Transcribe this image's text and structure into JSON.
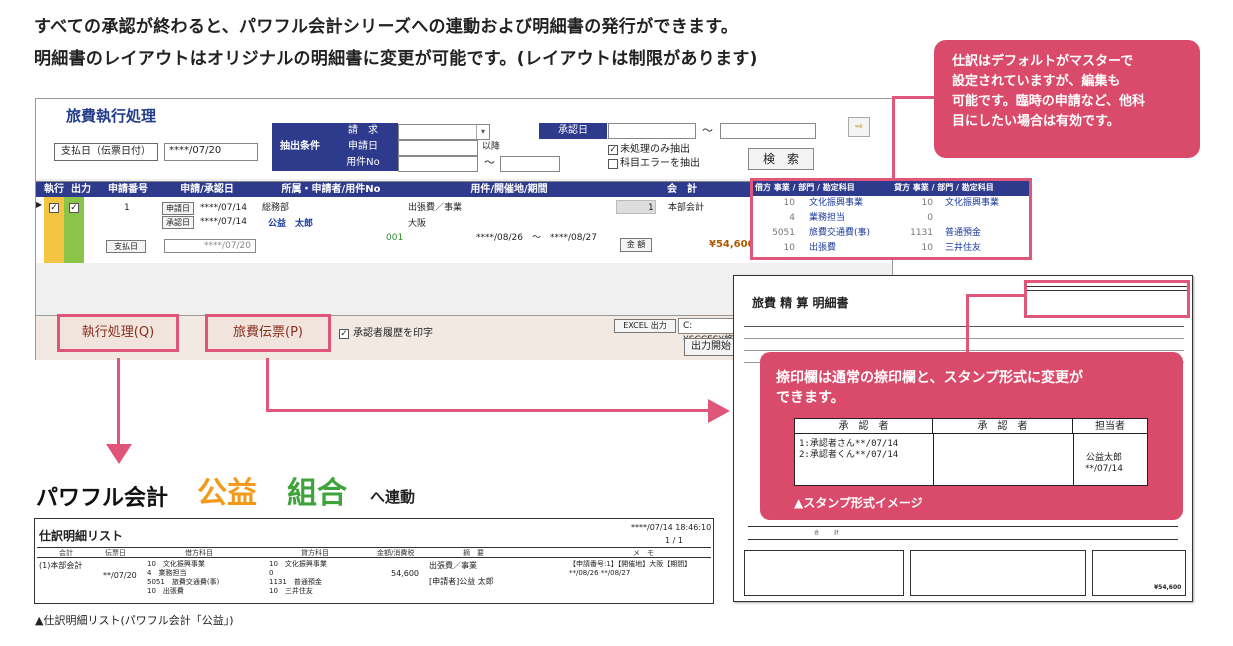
{
  "headline": {
    "line1": "すべての承認が終わると、パワフル会計シリーズへの連動および明細書の発行ができます。",
    "line2": "明細書のレイアウトはオリジナルの明細書に変更が可能です。(レイアウトは制限があります)"
  },
  "callout_top": "仕訳はデフォルトがマスターで設定されていますが、編集も可能です。臨時の申請など、他科目にしたい場合は有効です。",
  "callout_top_lines": [
    "仕訳はデフォルトがマスターで",
    "設定されていますが、編集も",
    "可能です。臨時の申請など、他科",
    "目にしたい場合は有効です。"
  ],
  "callout_stamp": {
    "lines": [
      "捺印欄は通常の捺印欄と、スタンプ形式に変更が",
      "できます。"
    ],
    "caption": "▲スタンプ形式イメージ",
    "headers": [
      "承　認　者",
      "承　認　者",
      "担当者"
    ],
    "approvers": [
      "1:承認者さん**/07/14",
      "2:承認者くん**/07/14"
    ],
    "person": [
      "公益太郎",
      "**/07/14"
    ]
  },
  "app": {
    "title": "旅費執行処理",
    "pay_label": "支払日（伝票日付）",
    "pay_value": "****/07/20",
    "filter_label": "抽出条件",
    "f_req": "請　求",
    "f_date": "申請日",
    "f_no": "用件No",
    "since": "以降",
    "tilde": "～",
    "approve_date": "承認日",
    "unprocessed": "未処理のみ抽出",
    "subject_error": "科目エラーを抽出",
    "search": "検　索",
    "headers": {
      "exec": "執行",
      "out": "出力",
      "no": "申請番号",
      "date": "申請/承認日",
      "dept": "所属・申請者/用件No",
      "purpose": "用件/開催地/期間",
      "account": "会　計",
      "debit": "借方 事業 / 部門 / 勘定科目",
      "credit": "貸方 事業 / 部門 / 勘定科目"
    },
    "row": {
      "no": "1",
      "req_btn": "申請日",
      "req_date": "****/07/14",
      "appr_btn": "承認日",
      "appr_date": "****/07/14",
      "pay_btn": "支払日",
      "pay_date": "****/07/20",
      "dept": "総務部",
      "person": "公益　太郎",
      "case_no": "001",
      "purpose": "出張費／事業",
      "place": "大阪",
      "period": "****/08/26　～　****/08/27",
      "account_no": "1",
      "account": "本部会計",
      "amount_btn": "金 額",
      "amount": "¥54,600",
      "debit": [
        {
          "code": "10",
          "name": "文化振興事業"
        },
        {
          "code": "4",
          "name": "業務担当"
        },
        {
          "code": "5051",
          "name": "旅費交通費(事)"
        },
        {
          "code": "10",
          "name": "出張費"
        }
      ],
      "credit": [
        {
          "code": "10",
          "name": "文化振興事業"
        },
        {
          "code": "0",
          "name": ""
        },
        {
          "code": "1131",
          "name": "普通預金"
        },
        {
          "code": "10",
          "name": "三井住友"
        }
      ]
    },
    "exec_btn": "執行処理(Q)",
    "voucher_btn": "旅費伝票(P)",
    "print_history": "承認者履歴を印字",
    "excel": "EXCEL 出力",
    "path": "C:¥SCCES¥旅",
    "output_start": "出力開始"
  },
  "paper": {
    "title": "旅費 精 算 明細書",
    "sum_label": "合　　　計",
    "total": "¥54,600"
  },
  "logo": {
    "part1": "パワフル会計",
    "part2": "公益",
    "part3": "組合",
    "part4": "へ連動"
  },
  "journal": {
    "title": "仕訳明細リスト",
    "datetime": "****/07/14 18:46:10",
    "page": "1 / 1",
    "headers": [
      "会計",
      "伝票日",
      "借方科目",
      "貸方科目",
      "金額/消費税",
      "摘　要",
      "メ　モ"
    ],
    "account": "(1)本部会計",
    "date": "**/07/20",
    "debit": [
      "10　文化振興事業",
      "4　業務担当",
      "5051　旅費交通費(事)",
      "10　出張費"
    ],
    "credit": [
      "10　文化振興事業",
      "0",
      "1131　普通預金",
      "10　三井住友"
    ],
    "amount": "54,600",
    "summary": "出張費／事業",
    "applicant": "[申請者]公益 太郎",
    "memo1": "【申請番号:1】【開催地】大阪【期間】",
    "memo2": "**/08/26 **/08/27"
  },
  "caption": "▲仕訳明細リスト(パワフル会計「公益」)"
}
